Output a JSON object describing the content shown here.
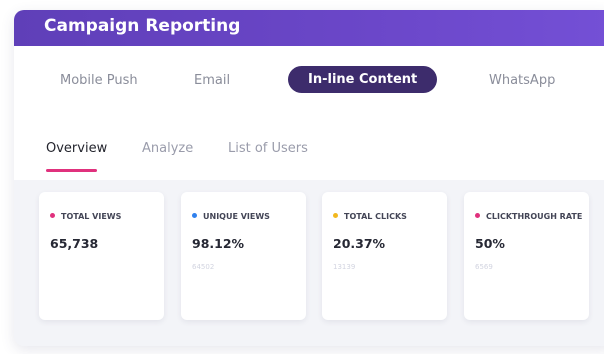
{
  "header": {
    "title": "Campaign Reporting"
  },
  "channels": [
    {
      "label": "Mobile Push",
      "active": false
    },
    {
      "label": "Email",
      "active": false
    },
    {
      "label": "In-line Content",
      "active": true
    },
    {
      "label": "WhatsApp",
      "active": false
    }
  ],
  "subtabs": [
    {
      "label": "Overview",
      "active": true
    },
    {
      "label": "Analyze",
      "active": false
    },
    {
      "label": "List of Users",
      "active": false
    }
  ],
  "stats": [
    {
      "label": "TOTAL VIEWS",
      "value": "65,738",
      "sub": "",
      "color": "#e0317d"
    },
    {
      "label": "UNIQUE VIEWS",
      "value": "98.12%",
      "sub": "64502",
      "color": "#2f80ed"
    },
    {
      "label": "TOTAL CLICKS",
      "value": "20.37%",
      "sub": "13139",
      "color": "#f2b81f"
    },
    {
      "label": "CLICKTHROUGH RATE",
      "value": "50%",
      "sub": "6569",
      "color": "#e0317d"
    }
  ],
  "colors": {
    "header": "#6b47c9",
    "active_channel": "#3d2c6c",
    "underline": "#e0317d"
  }
}
